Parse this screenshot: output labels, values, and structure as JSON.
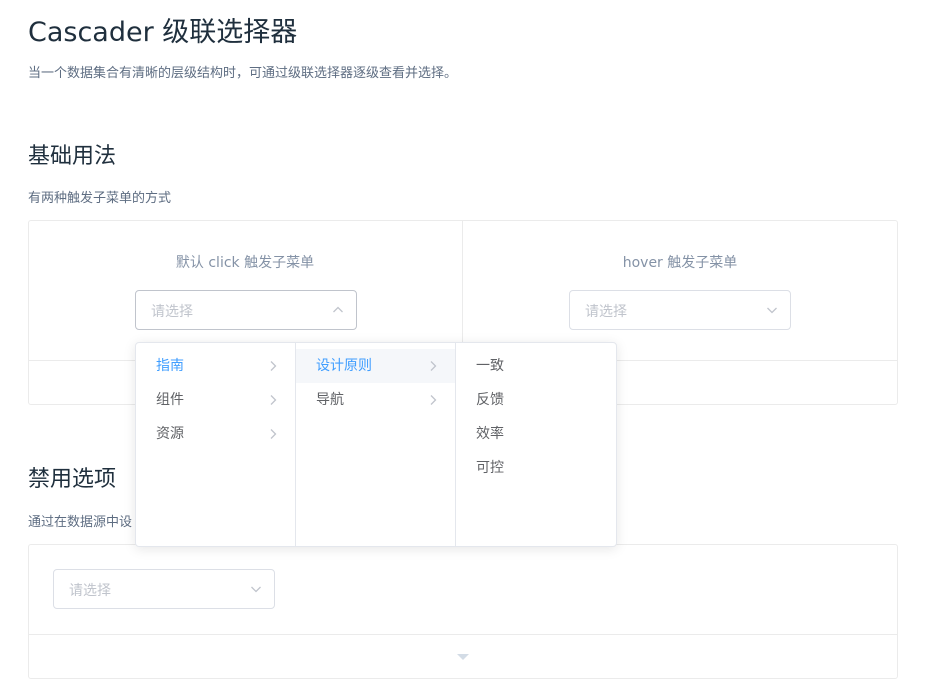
{
  "page": {
    "title": "Cascader 级联选择器",
    "description": "当一个数据集合有清晰的层级结构时，可通过级联选择器逐级查看并选择。"
  },
  "basic": {
    "title": "基础用法",
    "description": "有两种触发子菜单的方式",
    "click_label": "默认 click 触发子菜单",
    "hover_label": "hover 触发子菜单",
    "click_placeholder": "请选择",
    "hover_placeholder": "请选择"
  },
  "disabled": {
    "title": "禁用选项",
    "description": "通过在数据源中设",
    "placeholder": "请选择"
  },
  "menu": {
    "col1": [
      {
        "label": "指南",
        "active": true
      },
      {
        "label": "组件"
      },
      {
        "label": "资源"
      }
    ],
    "col2": [
      {
        "label": "设计原则",
        "active": true
      },
      {
        "label": "导航"
      }
    ],
    "col3": [
      {
        "label": "一致"
      },
      {
        "label": "反馈"
      },
      {
        "label": "效率"
      },
      {
        "label": "可控"
      }
    ]
  },
  "colors": {
    "accent": "#409eff",
    "text": "#606266",
    "placeholder": "#c0c4cc",
    "border": "#dcdfe6"
  },
  "icons": {
    "select_arrow": "chevron-down-icon",
    "select_arrow_open": "chevron-up-icon",
    "menu_expand": "chevron-right-icon",
    "demo_expand": "caret-down-icon"
  }
}
